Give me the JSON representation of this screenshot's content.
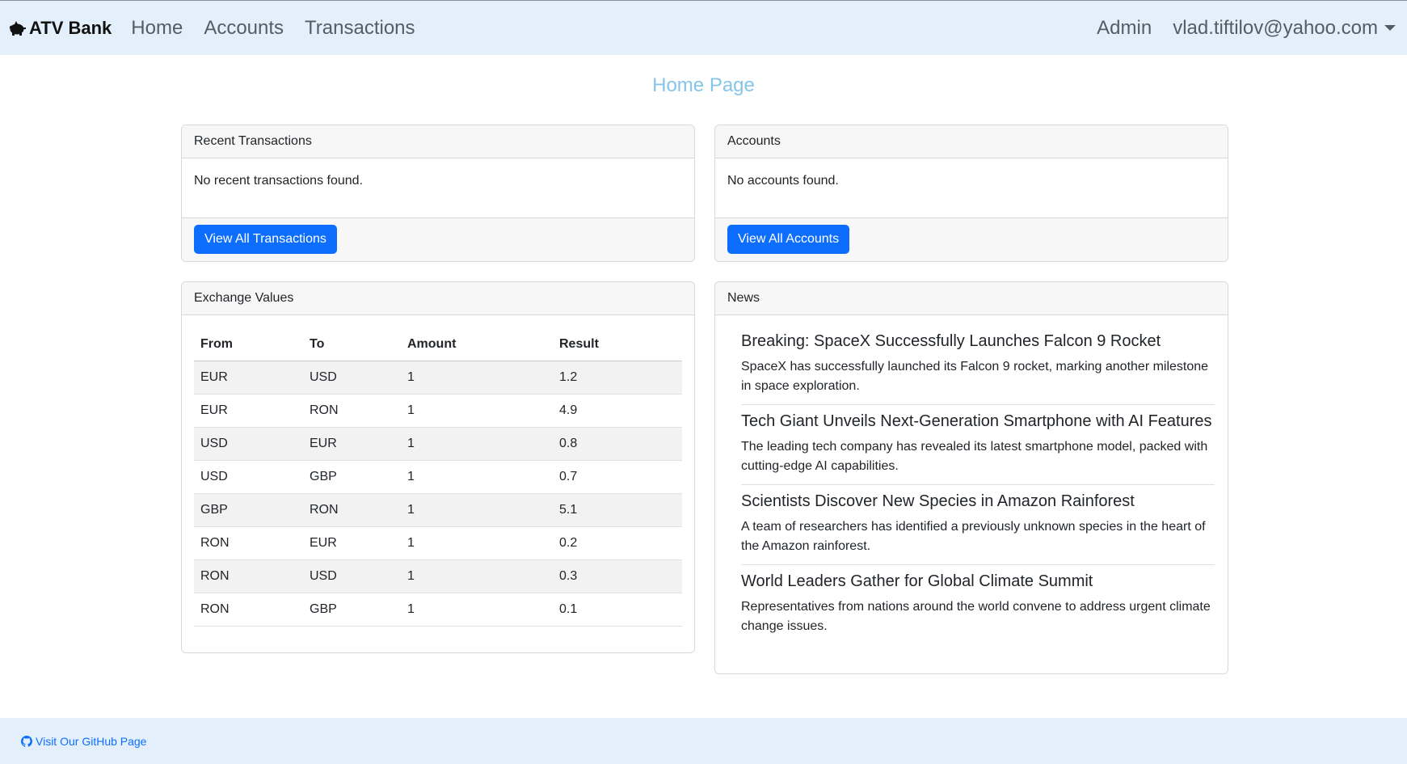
{
  "navbar": {
    "brand": "ATV Bank",
    "brand_icon": "piggy-bank-icon",
    "links": [
      "Home",
      "Accounts",
      "Transactions"
    ],
    "admin_label": "Admin",
    "user_email": "vlad.tiftilov@yahoo.com"
  },
  "page": {
    "title": "Home Page"
  },
  "recent_transactions": {
    "header": "Recent Transactions",
    "empty_text": "No recent transactions found.",
    "button_label": "View All Transactions"
  },
  "accounts": {
    "header": "Accounts",
    "empty_text": "No accounts found.",
    "button_label": "View All Accounts"
  },
  "exchange": {
    "header": "Exchange Values",
    "columns": [
      "From",
      "To",
      "Amount",
      "Result"
    ],
    "rows": [
      [
        "EUR",
        "USD",
        "1",
        "1.2"
      ],
      [
        "EUR",
        "RON",
        "1",
        "4.9"
      ],
      [
        "USD",
        "EUR",
        "1",
        "0.8"
      ],
      [
        "USD",
        "GBP",
        "1",
        "0.7"
      ],
      [
        "GBP",
        "RON",
        "1",
        "5.1"
      ],
      [
        "RON",
        "EUR",
        "1",
        "0.2"
      ],
      [
        "RON",
        "USD",
        "1",
        "0.3"
      ],
      [
        "RON",
        "GBP",
        "1",
        "0.1"
      ]
    ]
  },
  "news": {
    "header": "News",
    "items": [
      {
        "title": "Breaking: SpaceX Successfully Launches Falcon 9 Rocket",
        "text": "SpaceX has successfully launched its Falcon 9 rocket, marking another milestone in space exploration."
      },
      {
        "title": "Tech Giant Unveils Next-Generation Smartphone with AI Features",
        "text": "The leading tech company has revealed its latest smartphone model, packed with cutting-edge AI capabilities."
      },
      {
        "title": "Scientists Discover New Species in Amazon Rainforest",
        "text": "A team of researchers has identified a previously unknown species in the heart of the Amazon rainforest."
      },
      {
        "title": "World Leaders Gather for Global Climate Summit",
        "text": "Representatives from nations around the world convene to address urgent climate change issues."
      }
    ]
  },
  "footer": {
    "link_label": "Visit Our GitHub Page",
    "icon": "github-icon"
  },
  "colors": {
    "navbar_bg": "#e3f0fc",
    "primary": "#0d6efd",
    "title": "#85c5ea"
  }
}
